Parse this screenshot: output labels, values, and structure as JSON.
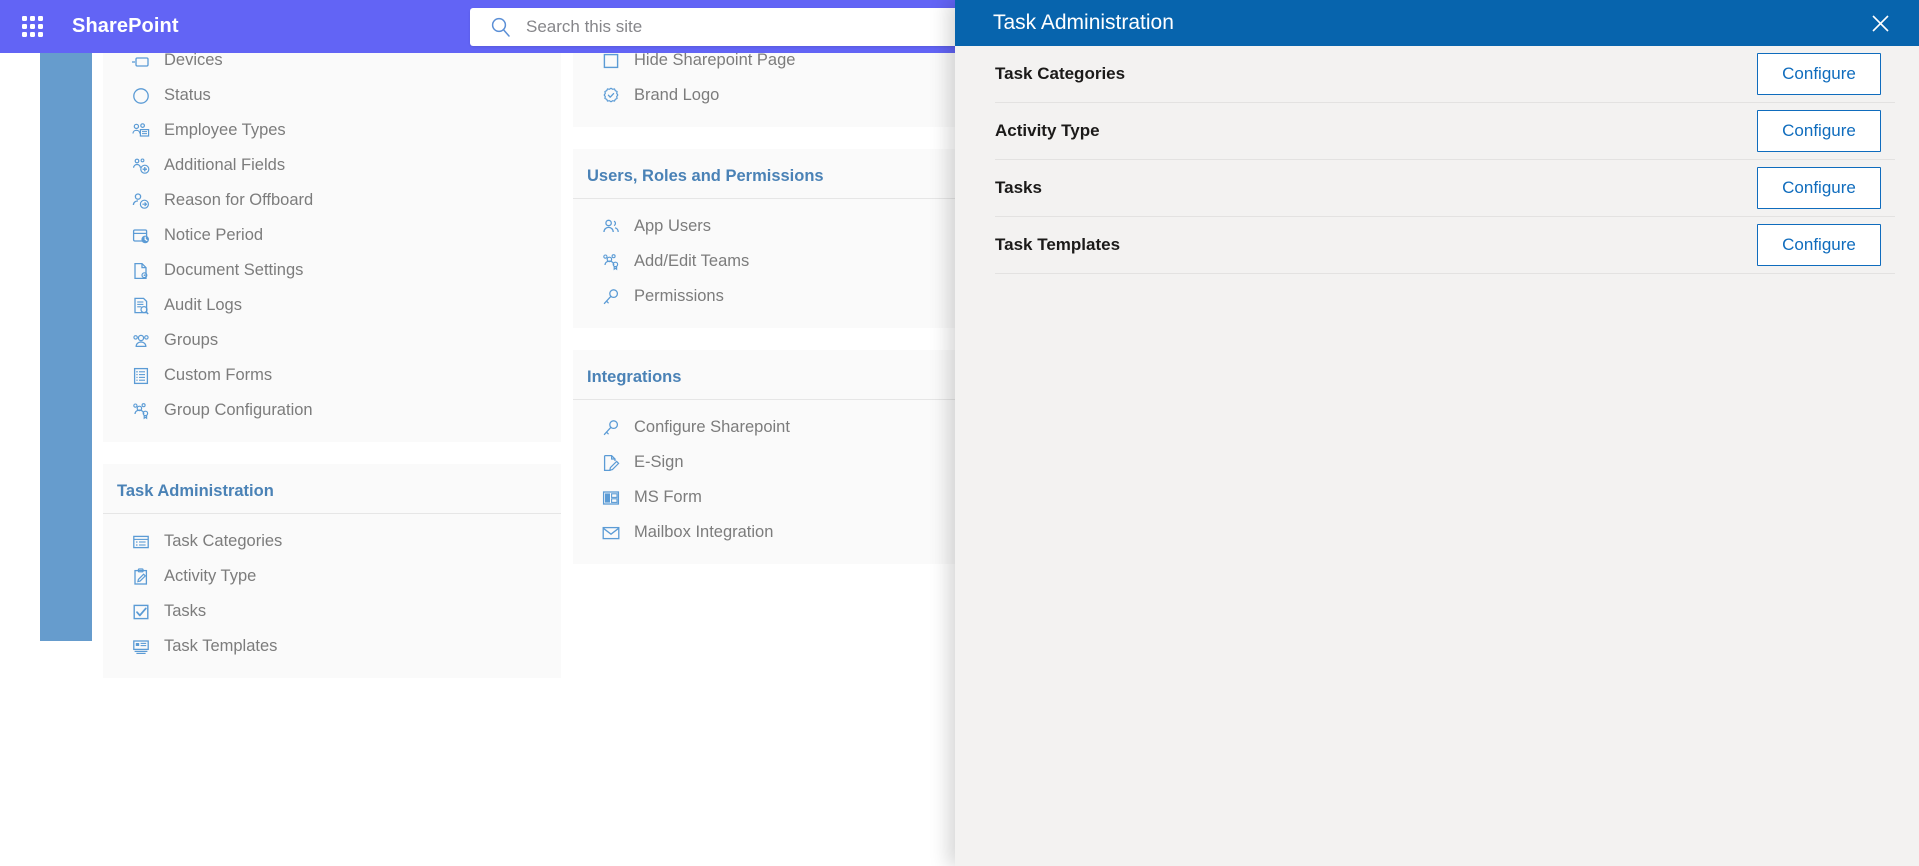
{
  "suite_bar": {
    "app_launcher_icon": "waffle-grid-icon",
    "brand": "SharePoint",
    "search": {
      "icon": "search-icon",
      "placeholder": "Search this site",
      "value": ""
    }
  },
  "colors": {
    "suite_bar_bg": "#6264f5",
    "panel_header_bg": "#0764ad",
    "panel_body_bg": "#f3f2f1",
    "rail_blue": "#669ccd",
    "section_title_blue": "#4a82b6",
    "nav_icon_blue": "#5b9bd5",
    "nav_label_gray": "#7c7c7c",
    "button_blue": "#0f6cbd"
  },
  "page_nav": {
    "column_1": [
      {
        "section_title": null,
        "items": [
          {
            "label": "Devices",
            "icon": "devices-icon",
            "clipped": true
          },
          {
            "label": "Status",
            "icon": "circle-status-icon"
          },
          {
            "label": "Employee Types",
            "icon": "employee-types-icon"
          },
          {
            "label": "Additional Fields",
            "icon": "add-fields-icon"
          },
          {
            "label": "Reason for Offboard",
            "icon": "offboard-user-icon"
          },
          {
            "label": "Notice Period",
            "icon": "notice-period-clock-icon"
          },
          {
            "label": "Document Settings",
            "icon": "document-settings-icon"
          },
          {
            "label": "Audit Logs",
            "icon": "audit-logs-icon"
          },
          {
            "label": "Groups",
            "icon": "groups-icon"
          },
          {
            "label": "Custom Forms",
            "icon": "custom-forms-icon"
          },
          {
            "label": "Group Configuration",
            "icon": "group-configuration-icon"
          }
        ]
      },
      {
        "section_title": "Task Administration",
        "items": [
          {
            "label": "Task Categories",
            "icon": "task-categories-icon"
          },
          {
            "label": "Activity Type",
            "icon": "activity-type-clipboard-icon"
          },
          {
            "label": "Tasks",
            "icon": "tasks-checkbox-icon"
          },
          {
            "label": "Task Templates",
            "icon": "task-templates-icon"
          }
        ]
      }
    ],
    "column_2": [
      {
        "section_title": null,
        "items": [
          {
            "label": "Hide Sharepoint Page",
            "icon": "checkbox-icon",
            "clipped": true
          },
          {
            "label": "Brand Logo",
            "icon": "brand-logo-badge-icon"
          }
        ]
      },
      {
        "section_title": "Users, Roles and Permissions",
        "items": [
          {
            "label": "App Users",
            "icon": "app-users-icon"
          },
          {
            "label": "Add/Edit Teams",
            "icon": "add-edit-teams-icon"
          },
          {
            "label": "Permissions",
            "icon": "permissions-key-icon"
          }
        ]
      },
      {
        "section_title": "Integrations",
        "items": [
          {
            "label": "Configure Sharepoint",
            "icon": "configure-sharepoint-key-icon"
          },
          {
            "label": "E-Sign",
            "icon": "e-sign-icon"
          },
          {
            "label": "MS Form",
            "icon": "ms-form-icon"
          },
          {
            "label": "Mailbox Integration",
            "icon": "mailbox-envelope-icon"
          }
        ]
      }
    ]
  },
  "panel": {
    "title": "Task Administration",
    "close_icon": "close-icon",
    "rows": [
      {
        "label": "Task Categories",
        "button": "Configure"
      },
      {
        "label": "Activity Type",
        "button": "Configure"
      },
      {
        "label": "Tasks",
        "button": "Configure"
      },
      {
        "label": "Task Templates",
        "button": "Configure"
      }
    ]
  }
}
